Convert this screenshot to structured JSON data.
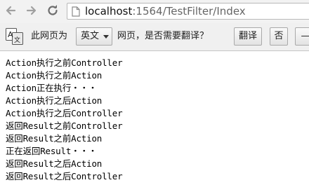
{
  "browser": {
    "url_host": "localhost",
    "url_rest": ":1564/TestFilter/Index"
  },
  "translate_bar": {
    "prefix": "此网页为",
    "language": "英文",
    "question": "网页，是否需要翻译？",
    "translate_label": "翻译",
    "no_label": "否",
    "more_label": "—"
  },
  "content": {
    "lines": [
      "Action执行之前Controller",
      "Action执行之前Action",
      "Action正在执行・・・",
      "Action执行之后Action",
      "Action执行之后Controller",
      "返回Result之前Controller",
      "返回Result之前Action",
      "正在返回Result・・・",
      "返回Result之后Action",
      "返回Result之后Controller"
    ]
  }
}
